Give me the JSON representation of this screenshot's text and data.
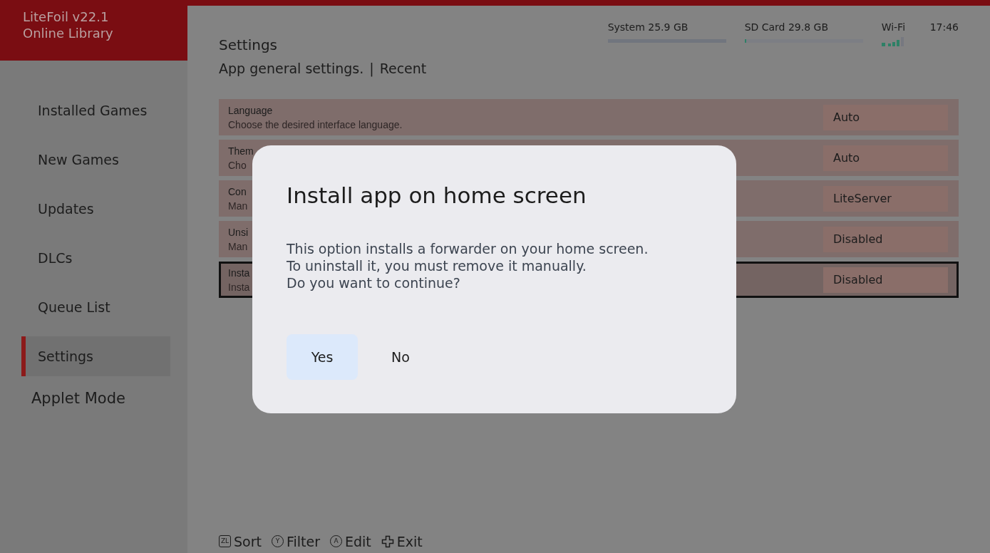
{
  "app": {
    "title": "LiteFoil v22.1",
    "subtitle": "Online Library"
  },
  "sidebar": {
    "items": [
      {
        "label": "Installed Games",
        "selected": false,
        "kind": "nav"
      },
      {
        "label": "New Games",
        "selected": false,
        "kind": "nav"
      },
      {
        "label": "Updates",
        "selected": false,
        "kind": "nav"
      },
      {
        "label": "DLCs",
        "selected": false,
        "kind": "nav"
      },
      {
        "label": "Queue List",
        "selected": false,
        "kind": "nav"
      },
      {
        "label": "Settings",
        "selected": true,
        "kind": "nav"
      },
      {
        "label": "Applet Mode",
        "selected": false,
        "kind": "mode"
      }
    ]
  },
  "header": {
    "title": "Settings",
    "subtitle": "App general settings.",
    "separator": "|",
    "link": "Recent"
  },
  "status": {
    "storage": [
      {
        "label": "System 25.9 GB",
        "level": 1.0
      },
      {
        "label": "SD Card 29.8 GB",
        "level": 0.01
      }
    ],
    "wifi": "Wi-Fi",
    "time": "17:46"
  },
  "settings": [
    {
      "title": "Language",
      "description": "Choose the desired interface language.",
      "value": "Auto",
      "selected": false
    },
    {
      "title": "Them",
      "description": "Cho",
      "value": "Auto",
      "selected": false
    },
    {
      "title": "Con",
      "description": "Man",
      "value": "LiteServer",
      "selected": false
    },
    {
      "title": "Unsi",
      "description": "Man",
      "value": "Disabled",
      "selected": false
    },
    {
      "title": "Insta",
      "description": "Insta",
      "value": "Disabled",
      "selected": true
    }
  ],
  "dialog": {
    "title": "Install app on home screen",
    "lines": [
      "This option installs a forwarder on your home screen.",
      "To uninstall it, you must remove it manually.",
      "Do you want to continue?"
    ],
    "buttons": [
      {
        "label": "Yes",
        "selected": true
      },
      {
        "label": "No",
        "selected": false
      }
    ]
  },
  "hints": [
    {
      "kind": "square",
      "key": "ZL",
      "label": "Sort"
    },
    {
      "kind": "circle",
      "key": "Y",
      "label": "Filter"
    },
    {
      "kind": "circle",
      "key": "A",
      "label": "Edit"
    },
    {
      "kind": "dpad",
      "label": "Exit"
    }
  ]
}
